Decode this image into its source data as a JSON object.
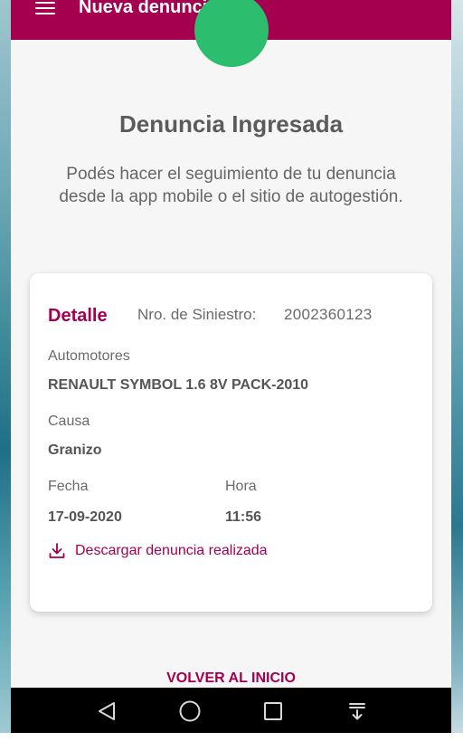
{
  "appbar": {
    "title": "Nueva denuncia",
    "menu_icon": "hamburger-menu-icon",
    "color": "#a4004f"
  },
  "status": {
    "icon": "success-circle",
    "color": "#2dbd6e",
    "heading": "Denuncia Ingresada",
    "message": "Podés hacer el seguimiento de tu denuncia desde la app mobile o el sitio de autogestión."
  },
  "card": {
    "title": "Detalle",
    "siniestro_label": "Nro. de Siniestro:",
    "siniestro_value": "2002360123",
    "automotores_label": "Automotores",
    "automotores_value": "RENAULT SYMBOL 1.6  8V PACK-2010",
    "causa_label": "Causa",
    "causa_value": "Granizo",
    "fecha_label": "Fecha",
    "fecha_value": "17-09-2020",
    "hora_label": "Hora",
    "hora_value": "11:56",
    "download_label": "Descargar denuncia realizada",
    "download_icon": "download-icon"
  },
  "actions": {
    "back_label": "VOLVER AL INICIO"
  },
  "navbar": {
    "icons": [
      "back-triangle-icon",
      "home-circle-icon",
      "recents-square-icon",
      "notification-drawer-icon"
    ]
  }
}
